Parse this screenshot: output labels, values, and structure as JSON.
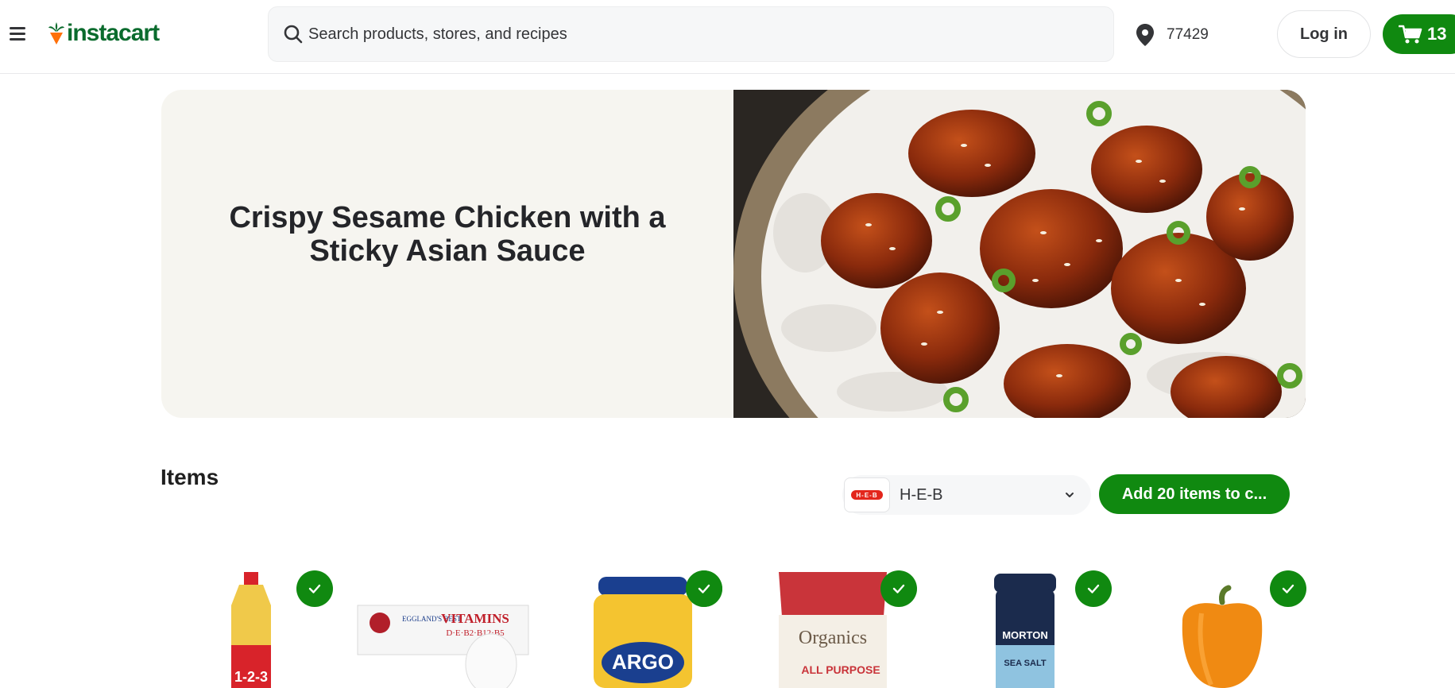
{
  "header": {
    "logo_text": "instacart",
    "search_placeholder": "Search products, stores, and recipes",
    "zip": "77429",
    "login_label": "Log in",
    "cart_count": "13"
  },
  "hero": {
    "title": "Crispy Sesame Chicken with a Sticky Asian Sauce",
    "image": "sesame-chicken-over-rice-photo"
  },
  "items": {
    "heading": "Items",
    "store": {
      "name": "H-E-B",
      "logo_text": "H-E-B"
    },
    "add_button_label": "Add 20 items to c...",
    "products": [
      {
        "name": "vegetable-oil-bottle",
        "label": "1-2-3",
        "selected": true
      },
      {
        "name": "eggs-carton",
        "label": "VITAMINS",
        "label2": "EGGLAND'S BEST",
        "label3": "D·E·B2·B12·B5",
        "selected": true
      },
      {
        "name": "argo-corn-starch",
        "label": "ARGO",
        "selected": true
      },
      {
        "name": "heb-organics-flour",
        "label": "Organics",
        "label2": "ALL PURPOSE",
        "selected": true
      },
      {
        "name": "morton-sea-salt",
        "label": "MORTON",
        "label2": "SEA SALT",
        "selected": true
      },
      {
        "name": "orange-bell-pepper",
        "label": "",
        "selected": true
      }
    ]
  },
  "colors": {
    "brand_green": "#108910",
    "logo_green": "#0a6b2d",
    "carrot_orange": "#ff7009",
    "hero_bg": "#f6f5f0"
  }
}
